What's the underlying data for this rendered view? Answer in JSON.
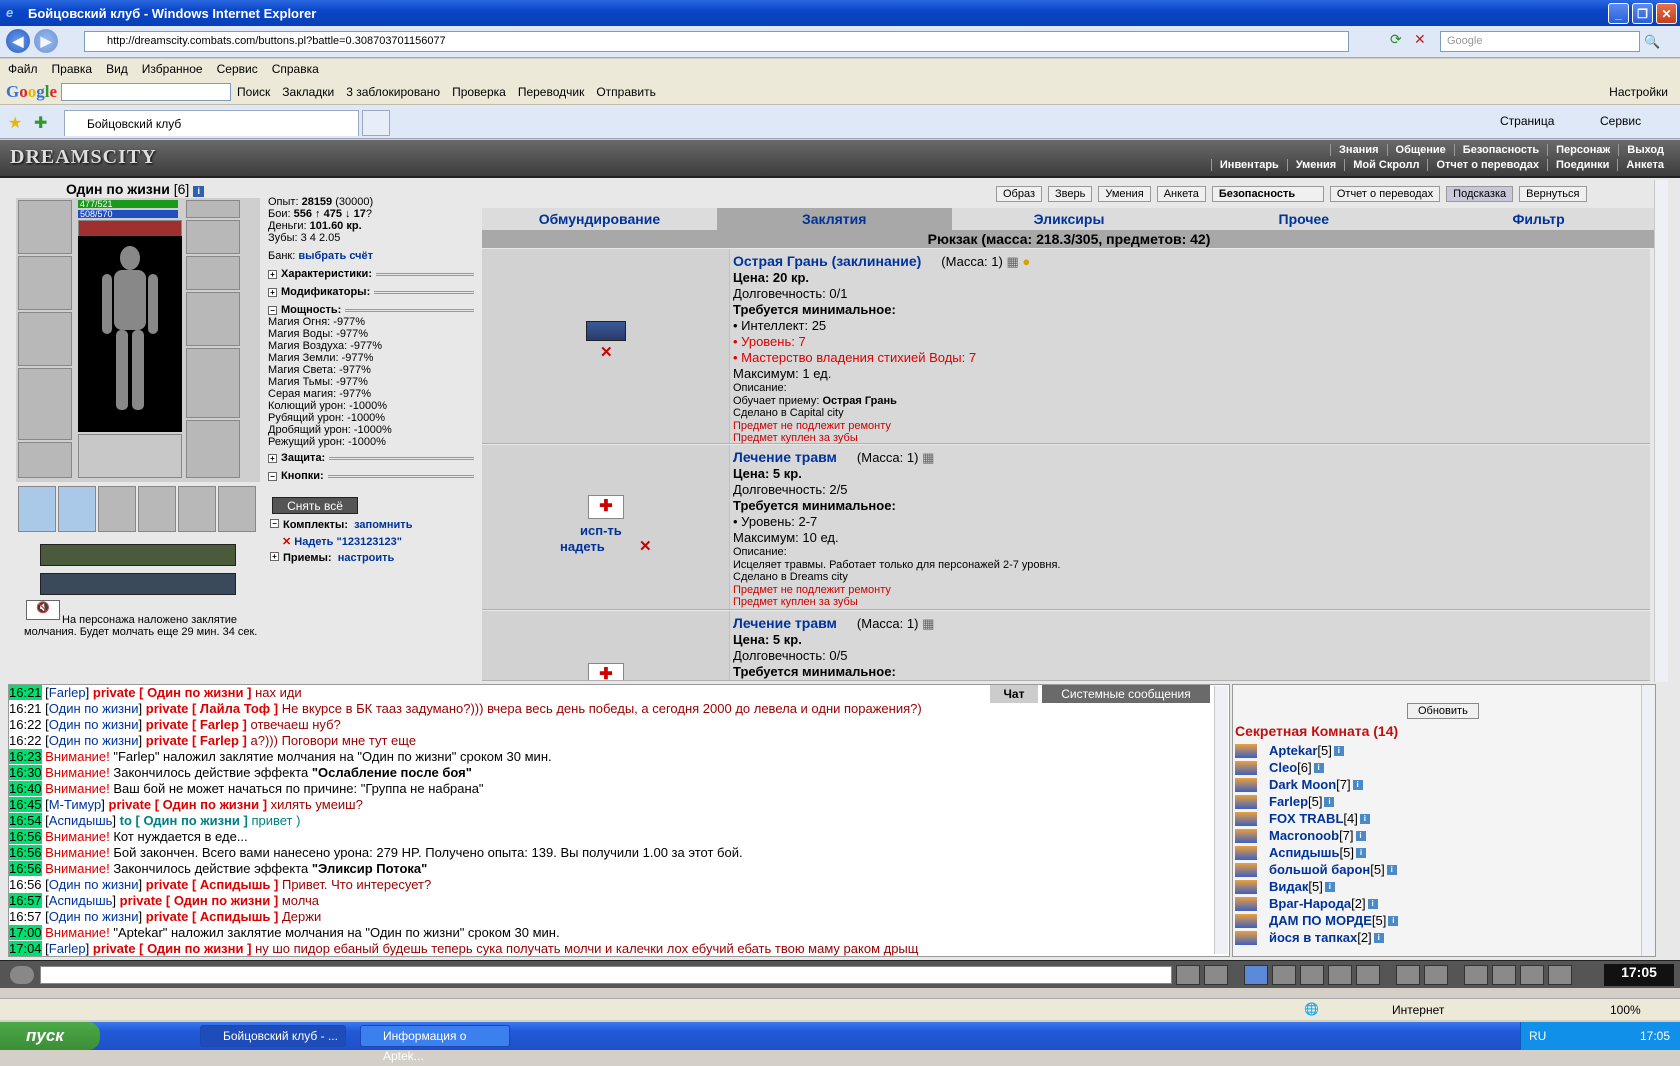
{
  "window": {
    "title": "Бойцовский клуб - Windows Internet Explorer"
  },
  "address": {
    "url": "http://dreamscity.combats.com/buttons.pl?battle=0.308703701156077",
    "search_placeholder": "Google"
  },
  "menu": [
    "Файл",
    "Правка",
    "Вид",
    "Избранное",
    "Сервис",
    "Справка"
  ],
  "gbar": {
    "logo": "Google",
    "items": [
      "Поиск",
      "Закладки",
      "3 заблокировано",
      "Проверка",
      "Переводчик",
      "Отправить"
    ],
    "settings": "Настройки"
  },
  "tab": {
    "label": "Бойцовский клуб"
  },
  "ie_cmd": {
    "page": "Страница",
    "service": "Сервис"
  },
  "game": {
    "logo": "DREAMSCITY",
    "topnav1": [
      "Знания",
      "Общение",
      "Безопасность",
      "Персонаж",
      "Выход"
    ],
    "topnav2": [
      "Инвентарь",
      "Умения",
      "Мой Скролл",
      "Отчет о переводах",
      "Поединки",
      "Анкета"
    ],
    "char": {
      "name": "Один по жизни",
      "level": "[6]",
      "hp": "477/521",
      "mana": "508/570"
    },
    "stats": {
      "exp_label": "Опыт:",
      "exp": "28159",
      "exp_next": "(30000)",
      "fights_label": "Бои:",
      "wins": "556",
      "losses": "475",
      "draws": "17",
      "money_label": "Деньги:",
      "money": "101.60 кр.",
      "teeth_label": "Зубы:",
      "teeth": "3 4 2.05",
      "bank_label": "Банк:",
      "bank_link": "выбрать счёт",
      "sect_chars": "Характеристики:",
      "sect_mods": "Модификаторы:",
      "sect_power": "Мощность:",
      "powers": [
        "Магия Огня: -977%",
        "Магия Воды: -977%",
        "Магия Воздуха: -977%",
        "Магия Земли: -977%",
        "Магия Света: -977%",
        "Магия Тьмы: -977%",
        "Серая магия: -977%",
        "Колющий урон: -1000%",
        "Рубящий урон: -1000%",
        "Дробящий урон: -1000%",
        "Режущий урон: -1000%"
      ],
      "sect_def": "Защита:",
      "sect_buttons": "Кнопки:",
      "remove_all": "Снять всё",
      "sect_sets": "Комплекты:",
      "remember": "запомнить",
      "set_wear": "Надеть \"123123123\"",
      "sect_tricks": "Приемы:",
      "configure": "настроить"
    },
    "silence": "На персонажа наложено заклятие молчания. Будет молчать еще 29 мин. 34 сек.",
    "buttons": [
      "Образ",
      "Зверь",
      "Умения",
      "Анкета",
      "Безопасность",
      "Отчет о переводах",
      "Подсказка",
      "Вернуться"
    ],
    "cattabs": [
      "Обмундирование",
      "Заклятия",
      "Эликсиры",
      "Прочее",
      "Фильтр"
    ],
    "backpack": "Рюкзак (масса: 218.3/305, предметов: 42)",
    "items": [
      {
        "title": "Острая Грань (заклинание)",
        "mass": "(Масса: 1)",
        "price": "Цена: 20 кр.",
        "dur": "Долговечность: 0/1",
        "req": "Требуется минимальное:",
        "reqs": [
          "• Интеллект: 25",
          "• Уровень: 7",
          "• Мастерство владения стихией Воды: 7"
        ],
        "max": "Максимум: 1 ед.",
        "desc_label": "Описание:",
        "teach_label": "Обучает приему:",
        "teach": "Острая Грань",
        "made": "Сделано в Capital city",
        "norepair": "Предмет не подлежит ремонту",
        "bought": "Предмет куплен за зубы"
      },
      {
        "title": "Лечение травм",
        "mass": "(Масса: 1)",
        "price": "Цена: 5 кр.",
        "dur": "Долговечность: 2/5",
        "req": "Требуется минимальное:",
        "reqs": [
          "• Уровень: 2-7"
        ],
        "max": "Максимум: 10 ед.",
        "desc_label": "Описание:",
        "text": "Исцеляет травмы. Работает только для персонажей 2-7 уровня.",
        "made": "Сделано в Dreams city",
        "norepair": "Предмет не подлежит ремонту",
        "bought": "Предмет куплен за зубы",
        "use": "исп-ть",
        "wear": "надеть"
      },
      {
        "title": "Лечение травм",
        "mass": "(Масса: 1)",
        "price": "Цена: 5 кр.",
        "dur": "Долговечность: 0/5",
        "req": "Требуется минимальное:"
      }
    ],
    "chat_tabs": [
      "Чат",
      "Системные сообщения"
    ],
    "chat": [
      {
        "t": "16:21",
        "hl": true,
        "from": "Farlep",
        "kind": "private",
        "to": "Один по жизни",
        "msg": "нах иди"
      },
      {
        "t": "16:21",
        "hl": false,
        "from": "Один по жизни",
        "kind": "private",
        "to": "Лайла Тоф",
        "msg": "Не вкурсе в БК тааз задумано?))) вчера весь день победы, а сегодня 2000 до левела и одни поражения?)"
      },
      {
        "t": "16:22",
        "hl": false,
        "from": "Один по жизни",
        "kind": "private",
        "to": "Farlep",
        "msg": "отвечаеш нуб?"
      },
      {
        "t": "16:22",
        "hl": false,
        "from": "Один по жизни",
        "kind": "private",
        "to": "Farlep",
        "msg": "а?))) Поговори мне тут еще"
      },
      {
        "t": "16:23",
        "hl": true,
        "sys": "Внимание!",
        "msg": "\"Farlep\" наложил заклятие молчания на \"Один по жизни\" сроком 30 мин."
      },
      {
        "t": "16:30",
        "hl": true,
        "sys": "Внимание!",
        "msg": "Закончилось действие эффекта",
        "bold": "\"Ослабление после боя\""
      },
      {
        "t": "16:40",
        "hl": true,
        "sys": "Внимание!",
        "msg": "Ваш бой не может начаться по причине: \"Группа не набрана\""
      },
      {
        "t": "16:45",
        "hl": true,
        "from": "М-Тимур",
        "kind": "private",
        "to": "Один по жизни",
        "msg": "хилять умеиш?"
      },
      {
        "t": "16:54",
        "hl": true,
        "from": "Аспидышь",
        "kind": "to",
        "to": "Один по жизни",
        "msg": "привет )"
      },
      {
        "t": "16:56",
        "hl": true,
        "sys": "Внимание!",
        "msg": "Кот нуждается в еде..."
      },
      {
        "t": "16:56",
        "hl": true,
        "sys": "Внимание!",
        "msg": "Бой закончен. Всего вами нанесено урона: 279 HP. Получено опыта: 139. Вы получили 1.00 за этот бой."
      },
      {
        "t": "16:56",
        "hl": true,
        "sys": "Внимание!",
        "msg": "Закончилось действие эффекта",
        "bold": "\"Эликсир Потока\""
      },
      {
        "t": "16:56",
        "hl": false,
        "from": "Один по жизни",
        "kind": "private",
        "to": "Аспидышь",
        "msg": "Привет. Что интересует?"
      },
      {
        "t": "16:57",
        "hl": true,
        "from": "Аспидышь",
        "kind": "private",
        "to": "Один по жизни",
        "msg": "молча"
      },
      {
        "t": "16:57",
        "hl": false,
        "from": "Один по жизни",
        "kind": "private",
        "to": "Аспидышь",
        "msg": "Держи"
      },
      {
        "t": "17:00",
        "hl": true,
        "sys": "Внимание!",
        "msg": "\"Aptekar\" наложил заклятие молчания на \"Один по жизни\" сроком 30 мин."
      },
      {
        "t": "17:04",
        "hl": true,
        "from": "Farlep",
        "kind": "private",
        "to": "Один по жизни",
        "msg": "ну шо пидор ебаный будешь теперь сука получать молчи и калечки лох ебучий ебать твою маму раком дрыщ"
      }
    ],
    "room": {
      "refresh": "Обновить",
      "title": "Секретная Комната (14)",
      "users": [
        {
          "n": "Aptekar",
          "l": "[5]"
        },
        {
          "n": "Cleo",
          "l": "[6]"
        },
        {
          "n": "Dark Moon",
          "l": "[7]"
        },
        {
          "n": "Farlep",
          "l": "[5]"
        },
        {
          "n": "FOX TRABL",
          "l": "[4]"
        },
        {
          "n": "Macronoob",
          "l": "[7]"
        },
        {
          "n": "Аспидышь",
          "l": "[5]"
        },
        {
          "n": "большой барон",
          "l": "[5]"
        },
        {
          "n": "Видак",
          "l": "[5]"
        },
        {
          "n": "Враг-Народа",
          "l": "[2]"
        },
        {
          "n": "ДАМ ПО МОРДЕ",
          "l": "[5]"
        },
        {
          "n": "йося в тапках",
          "l": "[2]"
        }
      ]
    },
    "clock": "17:05"
  },
  "status": {
    "zone": "Интернет",
    "zoom": "100%"
  },
  "taskbar": {
    "start": "пуск",
    "tasks": [
      "Бойцовский клуб - ...",
      "Информация о Aptek..."
    ],
    "lang": "RU",
    "time": "17:05"
  }
}
